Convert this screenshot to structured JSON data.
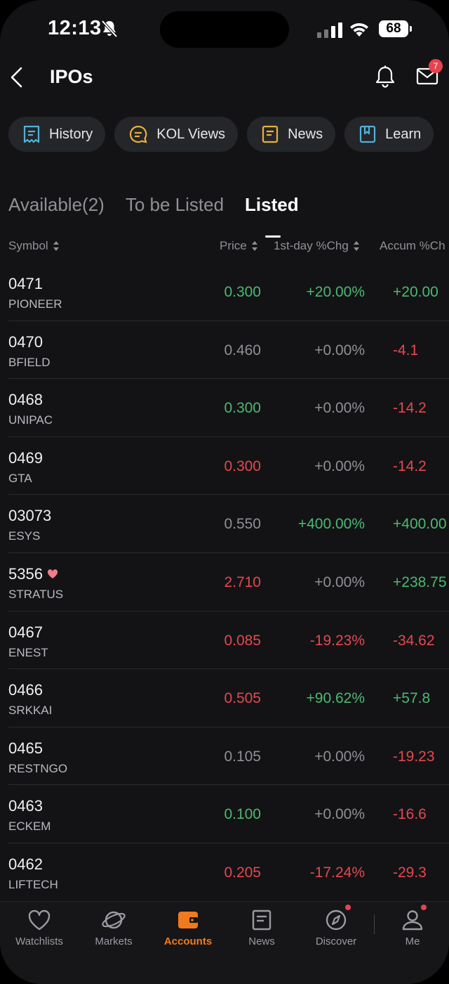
{
  "status_bar": {
    "time": "12:13",
    "battery": "68"
  },
  "header": {
    "title": "IPOs",
    "mail_badge": "7"
  },
  "chips": [
    {
      "label": "History",
      "icon": "history-icon",
      "color": "#4fb3d9"
    },
    {
      "label": "KOL Views",
      "icon": "kol-views-icon",
      "color": "#e8b13a"
    },
    {
      "label": "News",
      "icon": "news-icon",
      "color": "#e8b13a"
    },
    {
      "label": "Learn",
      "icon": "learn-icon",
      "color": "#4fb3d9"
    }
  ],
  "tabs": [
    {
      "label": "Available(2)",
      "active": false
    },
    {
      "label": "To be Listed",
      "active": false
    },
    {
      "label": "Listed",
      "active": true
    }
  ],
  "columns": {
    "symbol": "Symbol",
    "price": "Price",
    "first_day": "1st-day %Chg",
    "accum": "Accum %Ch"
  },
  "rows": [
    {
      "code": "0471",
      "name": "PIONEER",
      "price": "0.300",
      "price_color": "g",
      "first_day": "+20.00%",
      "first_day_color": "g",
      "accum": "+20.00",
      "accum_color": "g",
      "heart": false
    },
    {
      "code": "0470",
      "name": "BFIELD",
      "price": "0.460",
      "price_color": "n",
      "first_day": "+0.00%",
      "first_day_color": "n",
      "accum": "-4.1",
      "accum_color": "r",
      "heart": false
    },
    {
      "code": "0468",
      "name": "UNIPAC",
      "price": "0.300",
      "price_color": "g",
      "first_day": "+0.00%",
      "first_day_color": "n",
      "accum": "-14.2",
      "accum_color": "r",
      "heart": false
    },
    {
      "code": "0469",
      "name": "GTA",
      "price": "0.300",
      "price_color": "r",
      "first_day": "+0.00%",
      "first_day_color": "n",
      "accum": "-14.2",
      "accum_color": "r",
      "heart": false
    },
    {
      "code": "03073",
      "name": "ESYS",
      "price": "0.550",
      "price_color": "n",
      "first_day": "+400.00%",
      "first_day_color": "g",
      "accum": "+400.00",
      "accum_color": "g",
      "heart": false
    },
    {
      "code": "5356",
      "name": "STRATUS",
      "price": "2.710",
      "price_color": "r",
      "first_day": "+0.00%",
      "first_day_color": "n",
      "accum": "+238.75",
      "accum_color": "g",
      "heart": true
    },
    {
      "code": "0467",
      "name": "ENEST",
      "price": "0.085",
      "price_color": "r",
      "first_day": "-19.23%",
      "first_day_color": "r",
      "accum": "-34.62",
      "accum_color": "r",
      "heart": false
    },
    {
      "code": "0466",
      "name": "SRKKAI",
      "price": "0.505",
      "price_color": "r",
      "first_day": "+90.62%",
      "first_day_color": "g",
      "accum": "+57.8",
      "accum_color": "g",
      "heart": false
    },
    {
      "code": "0465",
      "name": "RESTNGO",
      "price": "0.105",
      "price_color": "n",
      "first_day": "+0.00%",
      "first_day_color": "n",
      "accum": "-19.23",
      "accum_color": "r",
      "heart": false
    },
    {
      "code": "0463",
      "name": "ECKEM",
      "price": "0.100",
      "price_color": "g",
      "first_day": "+0.00%",
      "first_day_color": "n",
      "accum": "-16.6",
      "accum_color": "r",
      "heart": false
    },
    {
      "code": "0462",
      "name": "LIFTECH",
      "price": "0.205",
      "price_color": "r",
      "first_day": "-17.24%",
      "first_day_color": "r",
      "accum": "-29.3",
      "accum_color": "r",
      "heart": false
    }
  ],
  "nav": [
    {
      "label": "Watchlists",
      "icon": "heart-outline-icon",
      "active": false,
      "dot": false
    },
    {
      "label": "Markets",
      "icon": "planet-icon",
      "active": false,
      "dot": false
    },
    {
      "label": "Accounts",
      "icon": "wallet-icon",
      "active": true,
      "dot": false
    },
    {
      "label": "News",
      "icon": "news-icon",
      "active": false,
      "dot": false
    },
    {
      "label": "Discover",
      "icon": "compass-icon",
      "active": false,
      "dot": true
    },
    {
      "label": "Me",
      "icon": "person-icon",
      "active": false,
      "dot": true
    }
  ],
  "colors": {
    "up": "#4cb96f",
    "down": "#e5484d",
    "neutral": "#8f9095",
    "accent": "#f07a1e",
    "badge": "#e8424f"
  }
}
